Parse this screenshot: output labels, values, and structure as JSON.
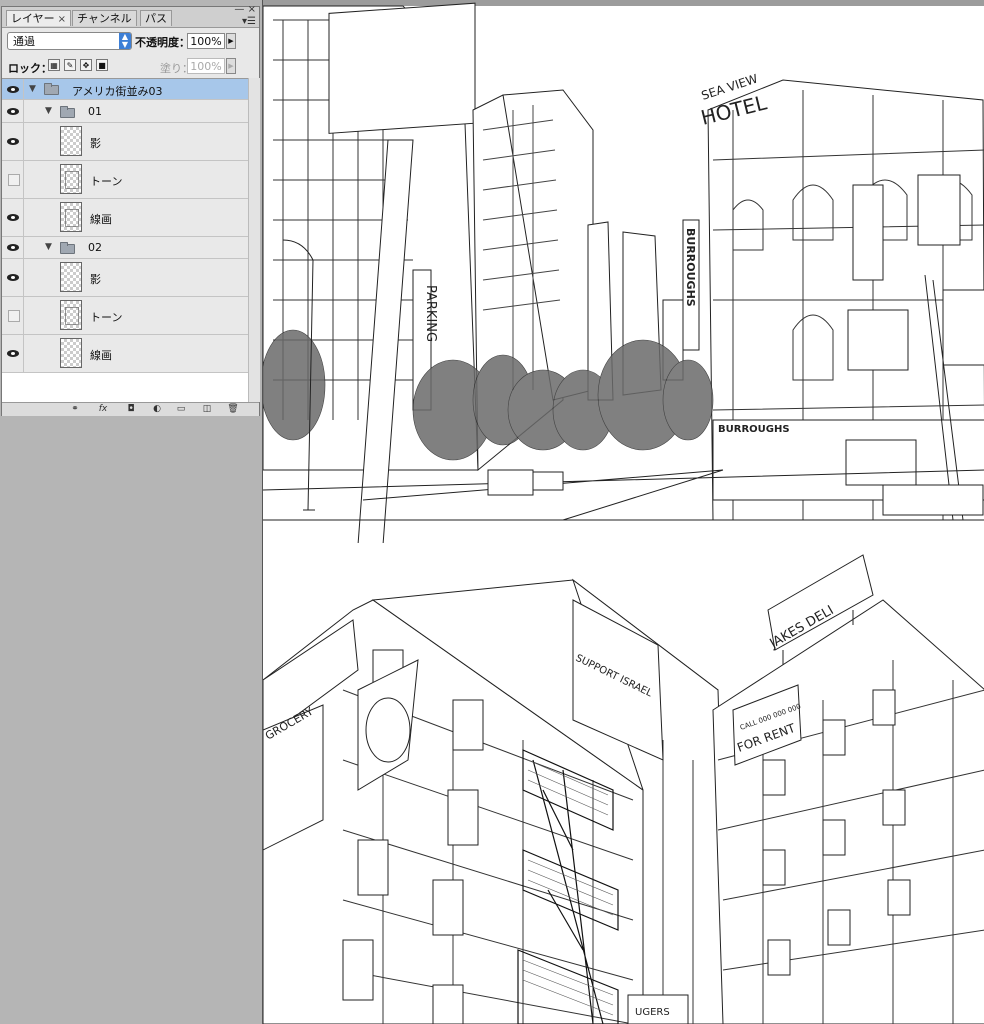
{
  "panel": {
    "tabs": [
      {
        "label": "レイヤー",
        "close": "×",
        "active": true
      },
      {
        "label": "チャンネル",
        "active": false
      },
      {
        "label": "パス",
        "active": false
      }
    ],
    "window_controls": {
      "minimize": "—",
      "close": "×"
    },
    "blend_mode": "通過",
    "opacity_label": "不透明度：",
    "opacity_value": "100%",
    "lock_label": "ロック：",
    "fill_label": "塗り：",
    "fill_value": "100%",
    "layers": [
      {
        "name": "アメリカ街並み03",
        "type": "group",
        "visible": true,
        "selected": true,
        "expanded": true
      },
      {
        "name": "01",
        "type": "group",
        "visible": true,
        "expanded": true
      },
      {
        "name": "影",
        "type": "layer",
        "visible": true
      },
      {
        "name": "トーン",
        "type": "layer",
        "visible": false
      },
      {
        "name": "線画",
        "type": "layer",
        "visible": true
      },
      {
        "name": "02",
        "type": "group",
        "visible": true,
        "expanded": true
      },
      {
        "name": "影",
        "type": "layer",
        "visible": true
      },
      {
        "name": "トーン",
        "type": "layer",
        "visible": false
      },
      {
        "name": "線画",
        "type": "layer",
        "visible": true
      }
    ],
    "bottom_icons": [
      "link-icon",
      "fx-icon",
      "mask-icon",
      "adjustment-icon",
      "folder-icon",
      "new-layer-icon",
      "trash-icon"
    ],
    "fx_label": "fx"
  },
  "artwork": {
    "signs": {
      "parking": "PARKING",
      "burroughs_vertical": "BURROUGHS",
      "hotel_top": "SEA VIEW",
      "hotel": "HOTEL",
      "burroughs_storefront": "BURROUGHS",
      "jakes_deli": "JAKES DELI",
      "for_rent": "FOR RENT",
      "for_rent_small": "CALL 000 000 000",
      "grocery": "GROCERY",
      "support_israel": "SUPPORT ISRAEL",
      "ugers": "UGERS"
    },
    "colors": {
      "line": "#222222",
      "tone": "#c8c8c8",
      "paper": "#ffffff",
      "desk": "#b5b5b5",
      "selection": "#a7c7ea"
    }
  }
}
